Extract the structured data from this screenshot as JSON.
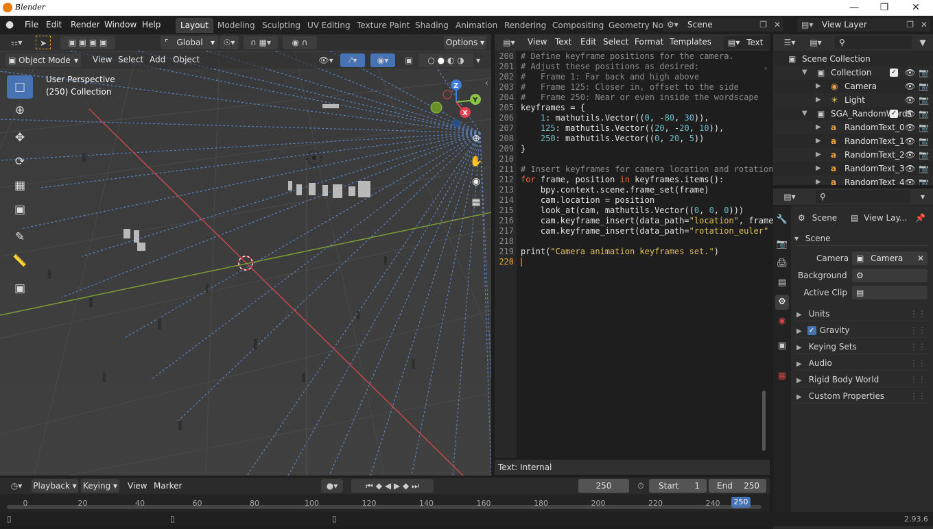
{
  "app": {
    "title": "Blender",
    "version": "2.93.6"
  },
  "menu": [
    "File",
    "Edit",
    "Render",
    "Window",
    "Help"
  ],
  "workspaces": [
    "Layout",
    "Modeling",
    "Sculpting",
    "UV Editing",
    "Texture Paint",
    "Shading",
    "Animation",
    "Rendering",
    "Compositing",
    "Geometry No"
  ],
  "scene_field": "Scene",
  "viewlayer_field": "View Layer",
  "viewport": {
    "transform_orientation": "Global",
    "options_label": "Options",
    "mode": "Object Mode",
    "header_menus": [
      "View",
      "Select",
      "Add",
      "Object"
    ],
    "overlay_title": "User Perspective",
    "overlay_subtitle": "(250) Collection",
    "gizmo_axes": {
      "z": "Z",
      "y": "Y",
      "x": "X"
    }
  },
  "text_editor": {
    "menus": [
      "View",
      "Text",
      "Edit",
      "Select",
      "Format",
      "Templates"
    ],
    "datablock": "Text",
    "footer": "Text: Internal",
    "lines": [
      {
        "n": "200",
        "code": "# Define keyframe positions for the camera."
      },
      {
        "n": "201",
        "code": "# Adjust these positions as desired:"
      },
      {
        "n": "202",
        "code": "#   Frame 1: Far back and high above"
      },
      {
        "n": "203",
        "code": "#   Frame 125: Closer in, offset to the side"
      },
      {
        "n": "204",
        "code": "#   Frame 250: Near or even inside the wordscape"
      },
      {
        "n": "205",
        "code": "keyframes = {"
      },
      {
        "n": "206",
        "code": "    1: mathutils.Vector((0, -80, 30)),"
      },
      {
        "n": "207",
        "code": "    125: mathutils.Vector((20, -20, 10)),"
      },
      {
        "n": "208",
        "code": "    250: mathutils.Vector((0, 20, 5))"
      },
      {
        "n": "209",
        "code": "}"
      },
      {
        "n": "210",
        "code": ""
      },
      {
        "n": "211",
        "code": "# Insert keyframes for camera location and rotation"
      },
      {
        "n": "212",
        "code": "for frame, position in keyframes.items():"
      },
      {
        "n": "213",
        "code": "    bpy.context.scene.frame_set(frame)"
      },
      {
        "n": "214",
        "code": "    cam.location = position"
      },
      {
        "n": "215",
        "code": "    look_at(cam, mathutils.Vector((0, 0, 0)))"
      },
      {
        "n": "216",
        "code": "    cam.keyframe_insert(data_path=\"location\", frame"
      },
      {
        "n": "217",
        "code": "    cam.keyframe_insert(data_path=\"rotation_euler\""
      },
      {
        "n": "218",
        "code": ""
      },
      {
        "n": "219",
        "code": "print(\"Camera animation keyframes set.\")"
      },
      {
        "n": "220",
        "code": ""
      }
    ]
  },
  "outliner": {
    "rows": [
      {
        "label": "Scene Collection",
        "indent": 0
      },
      {
        "label": "Collection",
        "indent": 1
      },
      {
        "label": "Camera",
        "indent": 2
      },
      {
        "label": "Light",
        "indent": 2
      },
      {
        "label": "SGA_RandomWords",
        "indent": 1
      },
      {
        "label": "RandomText_0",
        "indent": 2
      },
      {
        "label": "RandomText_1",
        "indent": 2
      },
      {
        "label": "RandomText_2",
        "indent": 2
      },
      {
        "label": "RandomText_3",
        "indent": 2
      },
      {
        "label": "RandomText_4",
        "indent": 2
      }
    ]
  },
  "properties": {
    "breadcrumb_scene": "Scene",
    "breadcrumb_viewlayer": "View Lay...",
    "panel_title": "Scene",
    "camera_label": "Camera",
    "camera_value": "Camera",
    "background_label": "Background ...",
    "active_clip_label": "Active Clip",
    "collapsed_panels": [
      "Units",
      "Gravity",
      "Keying Sets",
      "Audio",
      "Rigid Body World",
      "Custom Properties"
    ]
  },
  "timeline": {
    "menus": [
      "Playback",
      "Keying",
      "View",
      "Marker"
    ],
    "current_frame": "250",
    "start_label": "Start",
    "start_value": "1",
    "end_label": "End",
    "end_value": "250",
    "ticks": [
      "0",
      "20",
      "40",
      "60",
      "80",
      "100",
      "120",
      "140",
      "160",
      "180",
      "200",
      "220",
      "240"
    ],
    "playhead": "250"
  }
}
